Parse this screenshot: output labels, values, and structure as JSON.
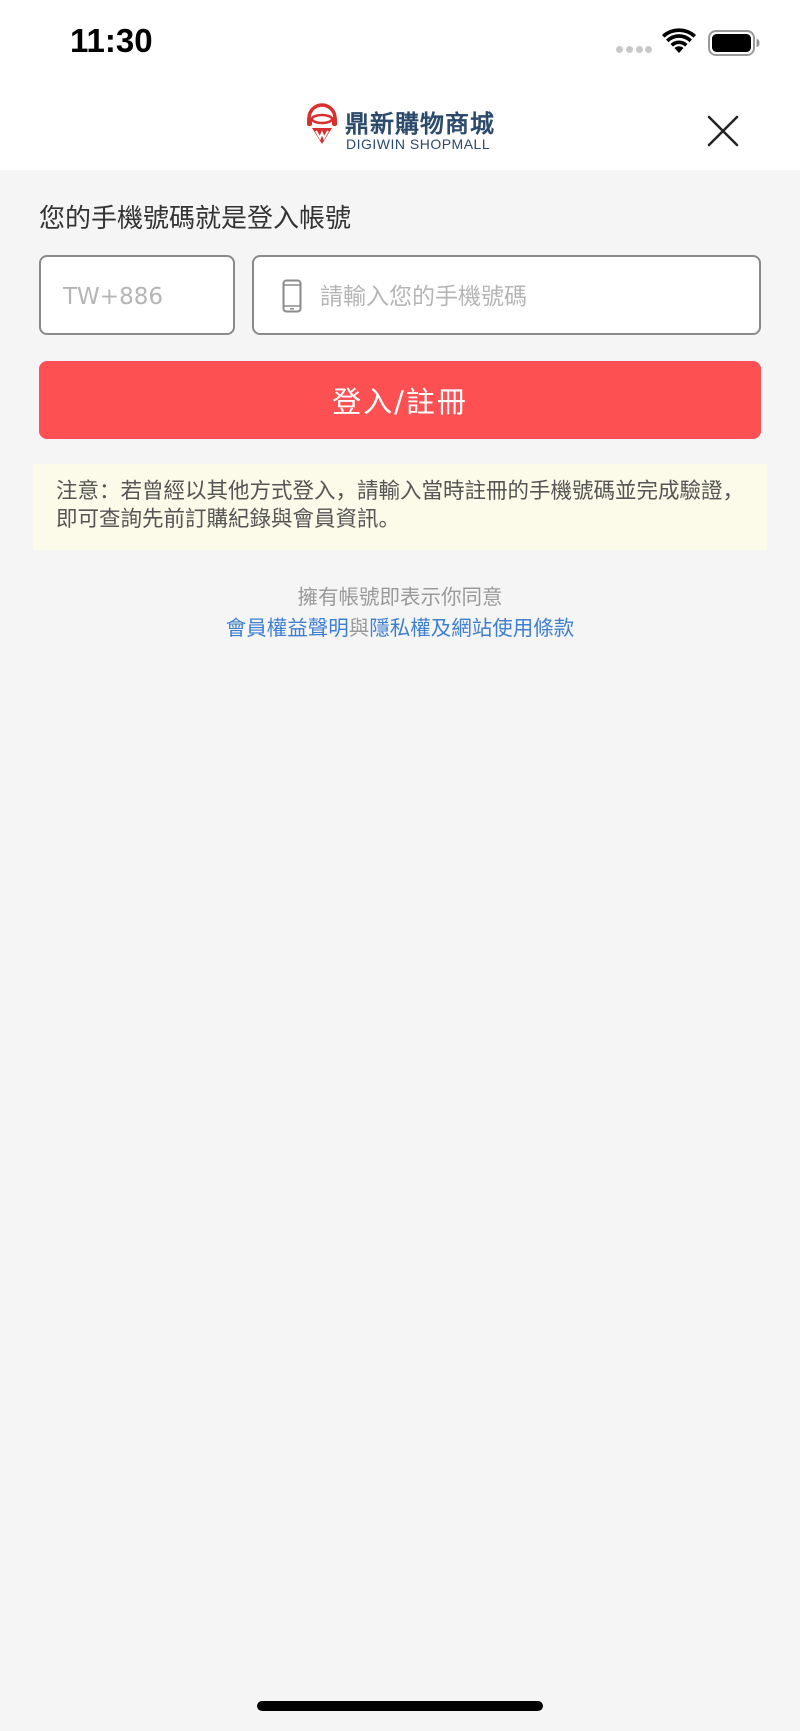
{
  "status_bar": {
    "time": "11:30"
  },
  "header": {
    "logo_title": "鼎新購物商城",
    "logo_subtitle": "DIGIWIN SHOPMALL"
  },
  "login": {
    "prompt": "您的手機號碼就是登入帳號",
    "country_code_placeholder": "TW+886",
    "phone_placeholder": "請輸入您的手機號碼",
    "submit_label": "登入/註冊"
  },
  "notice": {
    "text": "注意：若曾經以其他方式登入，請輸入當時註冊的手機號碼並完成驗證，即可查詢先前訂購紀錄與會員資訊。"
  },
  "terms": {
    "intro": "擁有帳號即表示你同意",
    "member_link": "會員權益聲明",
    "connector": "與",
    "privacy_link": "隱私權及網站使用條款"
  },
  "colors": {
    "primary": "#fd5052",
    "link": "#3e7fd0",
    "notice_bg": "#fcfae8",
    "page_bg": "#f5f5f5"
  }
}
